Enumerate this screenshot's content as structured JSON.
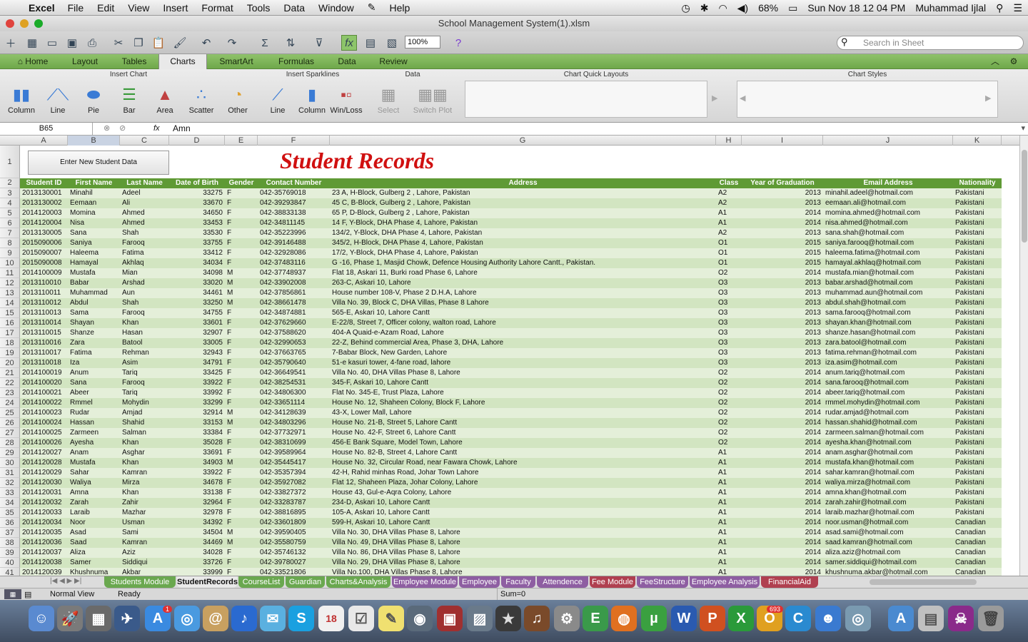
{
  "menubar": {
    "app": "Excel",
    "items": [
      "File",
      "Edit",
      "View",
      "Insert",
      "Format",
      "Tools",
      "Data",
      "Window",
      "Help"
    ],
    "battery": "68%",
    "datetime": "Sun Nov 18  12 04 PM",
    "user": "Muhammad Ijlal"
  },
  "window": {
    "title": "School Management System(1).xlsm"
  },
  "toolbar": {
    "zoom": "100%",
    "search_placeholder": "Search in Sheet"
  },
  "ribbon_tabs": [
    "Home",
    "Layout",
    "Tables",
    "Charts",
    "SmartArt",
    "Formulas",
    "Data",
    "Review"
  ],
  "ribbon": {
    "groups": [
      "Insert Chart",
      "Insert Sparklines",
      "Data",
      "Chart Quick Layouts",
      "Chart Styles"
    ],
    "insert_chart": [
      "Column",
      "Line",
      "Pie",
      "Bar",
      "Area",
      "Scatter",
      "Other"
    ],
    "sparklines": [
      "Line",
      "Column",
      "Win/Loss"
    ],
    "data": [
      "Select",
      "Switch Plot"
    ]
  },
  "formula": {
    "cell": "B65",
    "fx": "fx",
    "value": "Amn"
  },
  "columns": [
    "A",
    "B",
    "C",
    "D",
    "E",
    "F",
    "G",
    "H",
    "I",
    "J",
    "K"
  ],
  "sheet": {
    "button": "Enter New Student Data",
    "title": "Student Records",
    "headers": [
      "Student ID",
      "First Name",
      "Last Name",
      "Date of Birth",
      "Gender",
      "Contact Number",
      "Address",
      "Class",
      "Year of Graduation",
      "Email Address",
      "Nationality"
    ],
    "rows": [
      [
        "2013130001",
        "Minahil",
        "Adeel",
        "33275",
        "F",
        "042-35769018",
        "23 A, H-Block, Gulberg 2 , Lahore, Pakistan",
        "A2",
        "2013",
        "minahil.adeel@hotmail.com",
        "Pakistani"
      ],
      [
        "2013130002",
        "Eemaan",
        "Ali",
        "33670",
        "F",
        "042-39293847",
        "45 C, B-Block, Gulberg 2 , Lahore, Pakistan",
        "A2",
        "2013",
        "eemaan.ali@hotmail.com",
        "Pakistani"
      ],
      [
        "2014120003",
        "Momina",
        "Ahmed",
        "34650",
        "F",
        "042-38833138",
        "65 P, D-Block, Gulberg 2 , Lahore, Pakistan",
        "A1",
        "2014",
        "momina.ahmed@hotmail.com",
        "Pakistani"
      ],
      [
        "2014120004",
        "Nisa",
        "Ahmed",
        "33453",
        "F",
        "042-34811145",
        "14 F, Y-Block, DHA Phase 4, Lahore, Pakistan",
        "A1",
        "2014",
        "nisa.ahmed@hotmail.com",
        "Pakistani"
      ],
      [
        "2013130005",
        "Sana",
        "Shah",
        "33530",
        "F",
        "042-35223996",
        "134/2, Y-Block, DHA Phase 4, Lahore, Pakistan",
        "A2",
        "2013",
        "sana.shah@hotmail.com",
        "Pakistani"
      ],
      [
        "2015090006",
        "Saniya",
        "Farooq",
        "33755",
        "F",
        "042-39146488",
        "345/2, H-Block, DHA Phase 4, Lahore, Pakistan",
        "O1",
        "2015",
        "saniya.farooq@hotmail.com",
        "Pakistani"
      ],
      [
        "2015090007",
        "Haleema",
        "Fatima",
        "33412",
        "F",
        "042-32928086",
        "17/2, Y-Block, DHA Phase 4, Lahore, Pakistan",
        "O1",
        "2015",
        "haleema.fatima@hotmail.com",
        "Pakistani"
      ],
      [
        "2015090008",
        "Hamayal",
        "Akhlaq",
        "34034",
        "F",
        "042-37483116",
        "G -16, Phase 1, Masjid Chowk, Defence Housing Authority Lahore Cantt., Pakistan.",
        "O1",
        "2015",
        "hamayal.akhlaq@hotmail.com",
        "Pakistani"
      ],
      [
        "2014100009",
        "Mustafa",
        "Mian",
        "34098",
        "M",
        "042-37748937",
        "Flat 18, Askari 11, Burki road Phase 6, Lahore",
        "O2",
        "2014",
        "mustafa.mian@hotmail.com",
        "Pakistani"
      ],
      [
        "2013110010",
        "Babar",
        "Arshad",
        "33020",
        "M",
        "042-33902008",
        "263-C, Askari 10, Lahore",
        "O3",
        "2013",
        "babar.arshad@hotmail.com",
        "Pakistani"
      ],
      [
        "2013110011",
        "Muhammad",
        "Aun",
        "34461",
        "M",
        "042-37856861",
        "House number 108-V, Phase 2 D.H.A, Lahore",
        "O3",
        "2013",
        "muhammad.aun@hotmail.com",
        "Pakistani"
      ],
      [
        "2013110012",
        "Abdul",
        "Shah",
        "33250",
        "M",
        "042-38661478",
        "Villa No. 39, Block C, DHA Villas, Phase 8 Lahore",
        "O3",
        "2013",
        "abdul.shah@hotmail.com",
        "Pakistani"
      ],
      [
        "2013110013",
        "Sama",
        "Farooq",
        "34755",
        "F",
        "042-34874881",
        "565-E, Askari 10, Lahore Cantt",
        "O3",
        "2013",
        "sama.farooq@hotmail.com",
        "Pakistani"
      ],
      [
        "2013110014",
        "Shayan",
        "Khan",
        "33601",
        "F",
        "042-37629660",
        "E-22/8, Street 7, Officer colony, walton road, Lahore",
        "O3",
        "2013",
        "shayan.khan@hotmail.com",
        "Pakistani"
      ],
      [
        "2013110015",
        "Shanze",
        "Hasan",
        "32907",
        "F",
        "042-37588620",
        "404-A Quaid-e-Azam Road, Lahore",
        "O3",
        "2013",
        "shanze.hasan@hotmail.com",
        "Pakistani"
      ],
      [
        "2013110016",
        "Zara",
        "Batool",
        "33005",
        "F",
        "042-32990653",
        "22-Z, Behind commercial Area, Phase 3, DHA, Lahore",
        "O3",
        "2013",
        "zara.batool@hotmail.com",
        "Pakistani"
      ],
      [
        "2013110017",
        "Fatima",
        "Rehman",
        "32943",
        "F",
        "042-37663765",
        "7-Babar Block, New Garden, Lahore",
        "O3",
        "2013",
        "fatima.rehman@hotmail.com",
        "Pakistani"
      ],
      [
        "2013110018",
        "Iza",
        "Asim",
        "34791",
        "F",
        "042-35790640",
        "51-e kasuri tower, 4-fane road, lahore",
        "O3",
        "2013",
        "iza.asim@hotmail.com",
        "Pakistani"
      ],
      [
        "2014100019",
        "Anum",
        "Tariq",
        "33425",
        "F",
        "042-36649541",
        "Villa No. 40, DHA Villas Phase 8, Lahore",
        "O2",
        "2014",
        "anum.tariq@hotmail.com",
        "Pakistani"
      ],
      [
        "2014100020",
        "Sana",
        "Farooq",
        "33922",
        "F",
        "042-38254531",
        "345-F, Askari 10, Lahore Cantt",
        "O2",
        "2014",
        "sana.farooq@hotmail.com",
        "Pakistani"
      ],
      [
        "2014100021",
        "Abeer",
        "Tariq",
        "33992",
        "F",
        "042-34806300",
        "Flat No. 345-E, Trust Plaza, Lahore",
        "O2",
        "2014",
        "abeer.tariq@hotmail.com",
        "Pakistani"
      ],
      [
        "2014100022",
        "Rmmel",
        "Mohydin",
        "33299",
        "F",
        "042-33651114",
        "House No. 12, Shaheen Colony, Block F, Lahore",
        "O2",
        "2014",
        "rmmel.mohydin@hotmail.com",
        "Pakistani"
      ],
      [
        "2014100023",
        "Rudar",
        "Amjad",
        "32914",
        "M",
        "042-34128639",
        "43-X, Lower Mall, Lahore",
        "O2",
        "2014",
        "rudar.amjad@hotmail.com",
        "Pakistani"
      ],
      [
        "2014100024",
        "Hassan",
        "Shahid",
        "33153",
        "M",
        "042-34803296",
        "House No. 21-B, Street 5, Lahore Cantt",
        "O2",
        "2014",
        "hassan.shahid@hotmail.com",
        "Pakistani"
      ],
      [
        "2014100025",
        "Zarmeen",
        "Salman",
        "33384",
        "F",
        "042-37732971",
        "House No. 42-F, Street 6, Lahore Cantt",
        "O2",
        "2014",
        "zarmeen.salman@hotmail.com",
        "Pakistani"
      ],
      [
        "2014100026",
        "Ayesha",
        "Khan",
        "35028",
        "F",
        "042-38310699",
        "456-E Bank Square, Model Town, Lahore",
        "O2",
        "2014",
        "ayesha.khan@hotmail.com",
        "Pakistani"
      ],
      [
        "2014120027",
        "Anam",
        "Asghar",
        "33691",
        "F",
        "042-39589964",
        "House No. 82-B, Street 4, Lahore Cantt",
        "A1",
        "2014",
        "anam.asghar@hotmail.com",
        "Pakistani"
      ],
      [
        "2014120028",
        "Mustafa",
        "Khan",
        "34903",
        "M",
        "042-35445417",
        "House No. 32, Circular Road, near Fawara Chowk, Lahore",
        "A1",
        "2014",
        "mustafa.khan@hotmail.com",
        "Pakistani"
      ],
      [
        "2014120029",
        "Sahar",
        "Kamran",
        "33922",
        "F",
        "042-35357394",
        "42-H, Rahid minhas Road, Johar Town Lahore",
        "A1",
        "2014",
        "sahar.kamran@hotmail.com",
        "Pakistani"
      ],
      [
        "2014120030",
        "Waliya",
        "Mirza",
        "34678",
        "F",
        "042-35927082",
        "Flat 12, Shaheen Plaza, Johar Colony, Lahore",
        "A1",
        "2014",
        "waliya.mirza@hotmail.com",
        "Pakistani"
      ],
      [
        "2014120031",
        "Amna",
        "Khan",
        "33138",
        "F",
        "042-33827372",
        "House 43, Gul-e-Aqra Colony, Lahore",
        "A1",
        "2014",
        "amna.khan@hotmail.com",
        "Pakistani"
      ],
      [
        "2014120032",
        "Zarah",
        "Zahir",
        "32964",
        "F",
        "042-33283787",
        "234-D, Askari 10, Lahore Cantt",
        "A1",
        "2014",
        "zarah.zahir@hotmail.com",
        "Pakistani"
      ],
      [
        "2014120033",
        "Laraib",
        "Mazhar",
        "32978",
        "F",
        "042-38816895",
        "105-A, Askari 10, Lahore Cantt",
        "A1",
        "2014",
        "laraib.mazhar@hotmail.com",
        "Pakistani"
      ],
      [
        "2014120034",
        "Noor",
        "Usman",
        "34392",
        "F",
        "042-33601809",
        "599-H, Askari 10, Lahore Cantt",
        "A1",
        "2014",
        "noor.usman@hotmail.com",
        "Canadian"
      ],
      [
        "2014120035",
        "Asad",
        "Sami",
        "34504",
        "M",
        "042-39590405",
        "Villa No. 30, DHA Villas Phase 8, Lahore",
        "A1",
        "2014",
        "asad.sami@hotmail.com",
        "Canadian"
      ],
      [
        "2014120036",
        "Saad",
        "Kamran",
        "34469",
        "M",
        "042-35580759",
        "Villa No. 49, DHA Villas Phase 8, Lahore",
        "A1",
        "2014",
        "saad.kamran@hotmail.com",
        "Canadian"
      ],
      [
        "2014120037",
        "Aliza",
        "Aziz",
        "34028",
        "F",
        "042-35746132",
        "Villa No. 86, DHA Villas Phase 8, Lahore",
        "A1",
        "2014",
        "aliza.aziz@hotmail.com",
        "Canadian"
      ],
      [
        "2014120038",
        "Samer",
        "Siddiqui",
        "33726",
        "F",
        "042-39780027",
        "Villa No. 29, DHA Villas Phase 8, Lahore",
        "A1",
        "2014",
        "samer.siddiqui@hotmail.com",
        "Canadian"
      ],
      [
        "2014120039",
        "Khushnuma",
        "Akbar",
        "33999",
        "F",
        "042-33521806",
        "Villa No.100, DHA Villas Phase 8, Lahore",
        "A1",
        "2014",
        "khushnuma.akbar@hotmail.com",
        "Canadian"
      ]
    ]
  },
  "sheet_tabs": [
    {
      "label": "Students Module",
      "color": "#6aa84f"
    },
    {
      "label": "StudentRecords",
      "color": "#6aa84f"
    },
    {
      "label": "CourseList",
      "color": "#6aa84f"
    },
    {
      "label": "Guardian",
      "color": "#6aa84f"
    },
    {
      "label": "Charts&Analysis",
      "color": "#6aa84f"
    },
    {
      "label": "Employee Module",
      "color": "#8e5ea2"
    },
    {
      "label": "Employee",
      "color": "#8e5ea2"
    },
    {
      "label": "Faculty",
      "color": "#8e5ea2"
    },
    {
      "label": "Attendence",
      "color": "#8e5ea2"
    },
    {
      "label": "Fee Module",
      "color": "#b04050"
    },
    {
      "label": "FeeStructure",
      "color": "#8e5ea2"
    },
    {
      "label": "Employee Analysis",
      "color": "#8e5ea2"
    },
    {
      "label": "FinancialAid",
      "color": "#b04050"
    }
  ],
  "status": {
    "view": "Normal View",
    "state": "Ready",
    "sum": "Sum=0"
  },
  "dock": {
    "badge_mail": "1",
    "badge_app": "693",
    "calendar_day": "18"
  }
}
